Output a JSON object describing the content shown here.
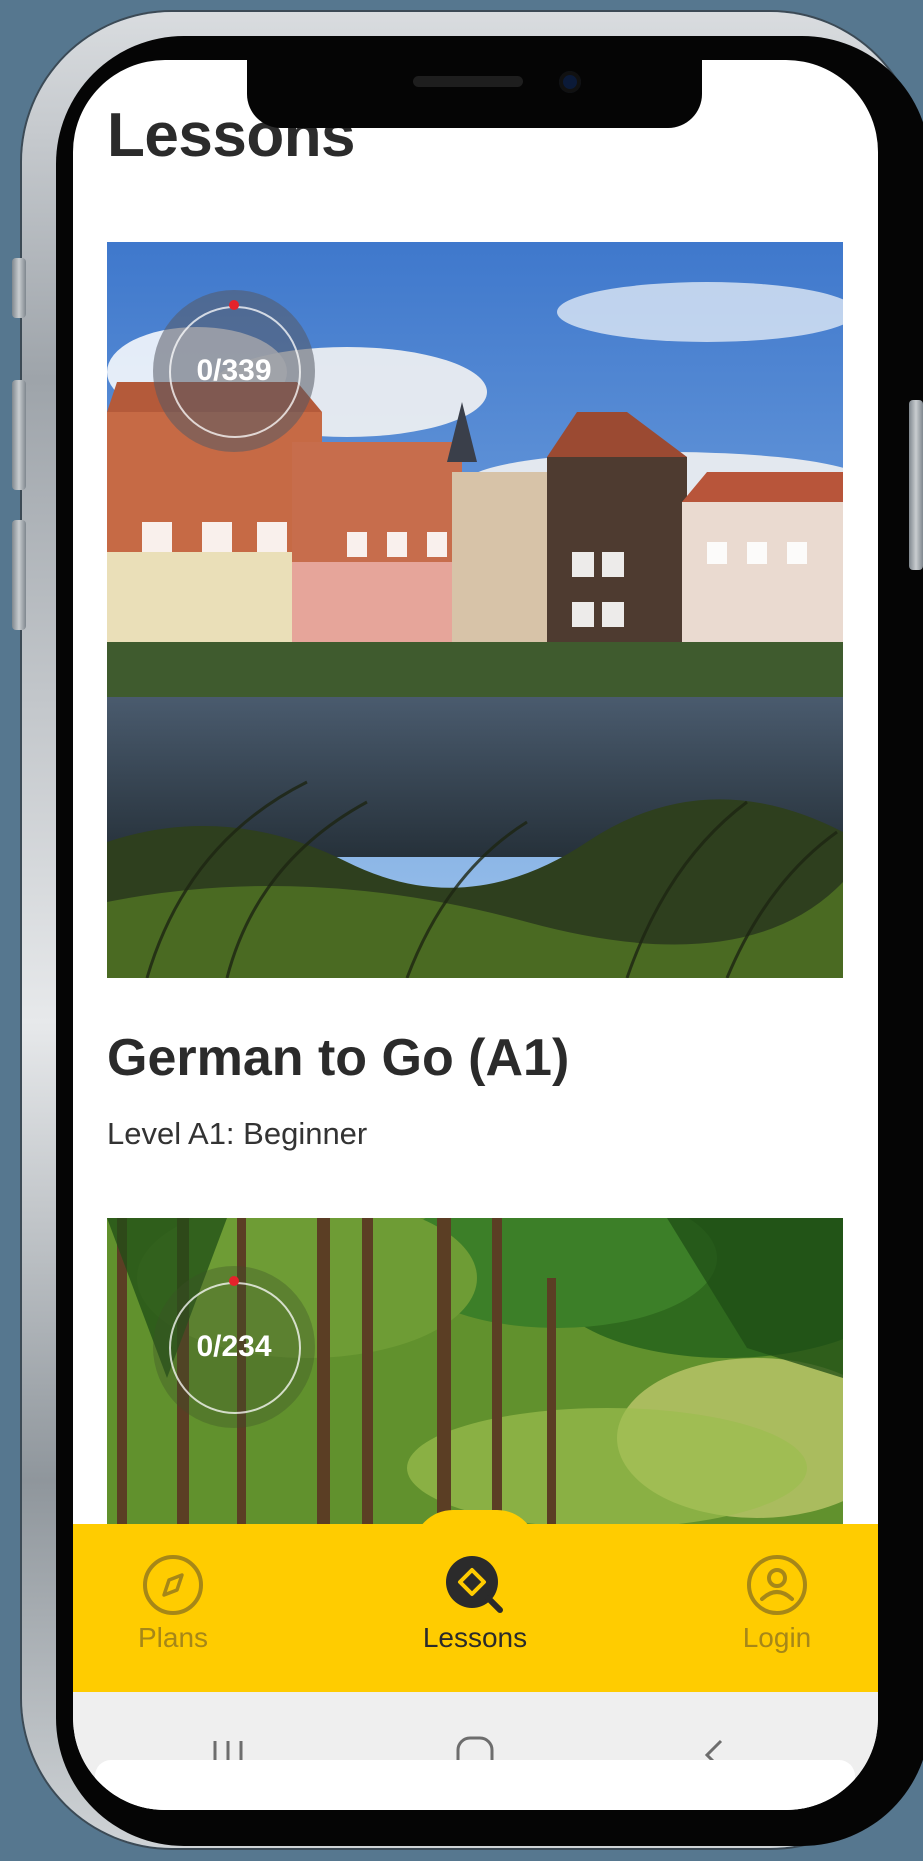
{
  "page": {
    "title": "Lessons"
  },
  "courses": [
    {
      "title": "German to Go (A1)",
      "subtitle": "Level A1: Beginner",
      "progress_text": "0/339",
      "progress_value": 0
    },
    {
      "progress_text": "0/234",
      "progress_value": 0
    }
  ],
  "tabbar": {
    "tabs": [
      {
        "label": "Plans",
        "icon": "compass-icon",
        "active": false
      },
      {
        "label": "Lessons",
        "icon": "lessons-search-icon",
        "active": true
      },
      {
        "label": "Login",
        "icon": "user-icon",
        "active": false
      }
    ]
  },
  "colors": {
    "accent": "#ffcc00",
    "progress_dot": "#e4232b",
    "text_dark": "#2b2b2b",
    "tab_inactive": "#a68718"
  },
  "system_nav": {
    "recent_icon": "recent-apps-icon",
    "home_icon": "home-icon",
    "back_icon": "back-icon"
  }
}
